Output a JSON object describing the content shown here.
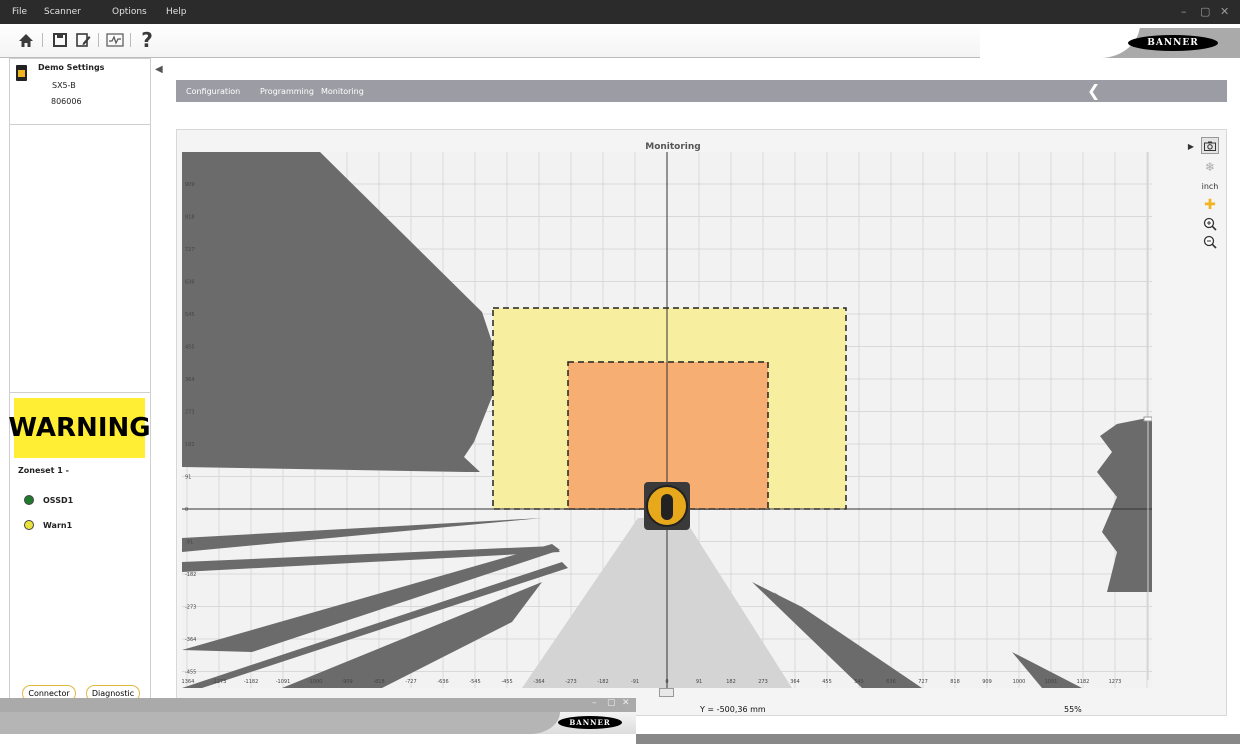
{
  "menubar": {
    "items": [
      {
        "label": "File"
      },
      {
        "label": "Scanner"
      },
      {
        "label": "Options"
      },
      {
        "label": "Help"
      }
    ],
    "window_controls": {
      "minimize": "–",
      "restore": "▢",
      "close": "✕"
    }
  },
  "toolbar": {
    "icons": [
      "home-icon",
      "save-icon",
      "edit-document-icon",
      "monitor-graph-icon",
      "help-icon"
    ],
    "help_label": "?",
    "brand": "BANNER"
  },
  "device": {
    "name": "Demo Settings",
    "model": "SX5-B",
    "serial": "806006"
  },
  "status": {
    "warning": "WARNING",
    "zoneset": "Zoneset 1 -",
    "outputs": [
      {
        "label": "OSSD1",
        "color": "#1f7a2e"
      },
      {
        "label": "Warn1",
        "color": "#e8e23a"
      }
    ],
    "buttons": [
      "Connector",
      "Diagnostic"
    ]
  },
  "nav": {
    "tabs": [
      "Configuration",
      "Programming",
      "Monitoring"
    ],
    "back_label": "❮"
  },
  "monitor": {
    "title": "Monitoring",
    "y_ticks": [
      "1000",
      "909",
      "818",
      "727",
      "636",
      "545",
      "455",
      "364",
      "273",
      "182",
      "91",
      "0",
      "-91",
      "-182",
      "-273",
      "-364",
      "-455"
    ],
    "x_ticks": [
      "-1364",
      "-1273",
      "-1182",
      "-1091",
      "-1000",
      "-909",
      "-818",
      "-727",
      "-636",
      "-545",
      "-455",
      "-364",
      "-273",
      "-182",
      "-91",
      "0",
      "91",
      "182",
      "273",
      "364",
      "455",
      "545",
      "636",
      "727",
      "818",
      "909",
      "1000",
      "1091",
      "1182",
      "1273",
      "1364"
    ],
    "warning_zone_color": "#f7eea0",
    "protective_zone_color": "#f7ae73",
    "shadow_color": "#6b6b6b",
    "unit_label": "inch",
    "cursor_readout": "Y = -500,36 mm",
    "zoom": "55%"
  },
  "second_window": {
    "brand": "BANNER",
    "window_controls": {
      "minimize": "–",
      "restore": "▢",
      "close": "✕"
    }
  }
}
